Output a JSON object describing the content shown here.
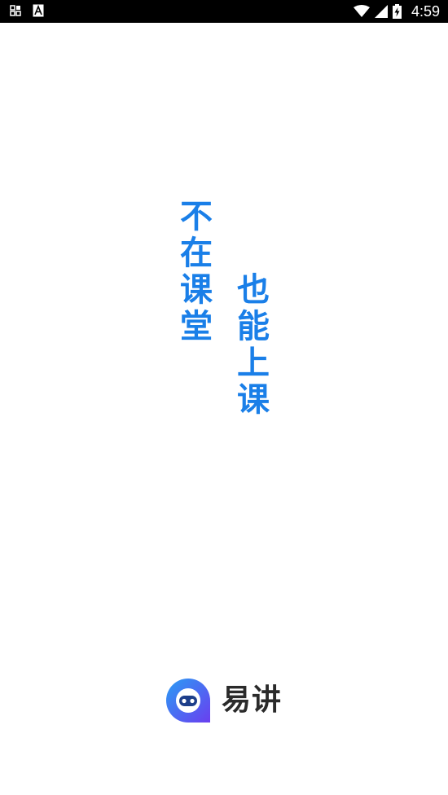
{
  "status_bar": {
    "time": "4:59",
    "left_icons": [
      "notification-grid-icon",
      "font-a-icon"
    ],
    "right_icons": [
      "wifi-icon",
      "signal-icon",
      "battery-charging-icon"
    ]
  },
  "slogan": {
    "left_column": [
      "不",
      "在",
      "课",
      "堂"
    ],
    "right_column": [
      "也",
      "能",
      "上",
      "课"
    ],
    "color": "#1a7fe8"
  },
  "logo": {
    "name": "易讲",
    "icon": "robot-chat-bubble-icon",
    "colors": {
      "gradient_start": "#2a9df4",
      "gradient_end": "#6a3ef0"
    }
  }
}
